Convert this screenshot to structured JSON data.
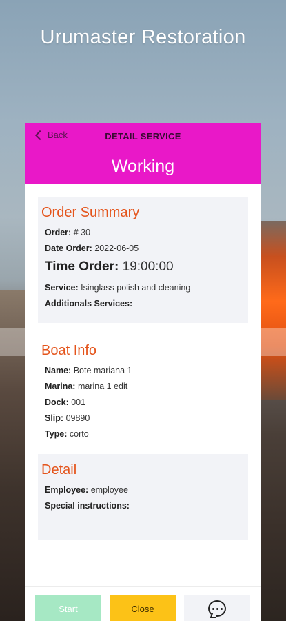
{
  "app_title": "Urumaster Restoration",
  "header": {
    "back_label": "Back",
    "title": "DETAIL SERVICE",
    "status": "Working"
  },
  "order_summary": {
    "heading": "Order Summary",
    "order_label": "Order:",
    "order_value": "# 30",
    "date_label": "Date Order:",
    "date_value": "2022-06-05",
    "time_label": "Time Order:",
    "time_value": "19:00:00",
    "service_label": "Service:",
    "service_value": "Isinglass polish and cleaning",
    "additionals_label": "Additionals Services:"
  },
  "boat_info": {
    "heading": "Boat Info",
    "name_label": "Name:",
    "name_value": "Bote mariana 1",
    "marina_label": "Marina:",
    "marina_value": "marina 1 edit",
    "dock_label": "Dock:",
    "dock_value": "001",
    "slip_label": "Slip:",
    "slip_value": "09890",
    "type_label": "Type:",
    "type_value": "corto"
  },
  "detail": {
    "heading": "Detail",
    "employee_label": "Employee:",
    "employee_value": "employee",
    "instructions_label": "Special instructions:"
  },
  "footer": {
    "start_label": "Start",
    "close_label": "Close",
    "chat_icon": "chat-bubble-icon"
  },
  "colors": {
    "header_bg": "#e918c8",
    "section_heading": "#e4541b",
    "start_button": "#a6e8c4",
    "close_button": "#fcc217"
  }
}
